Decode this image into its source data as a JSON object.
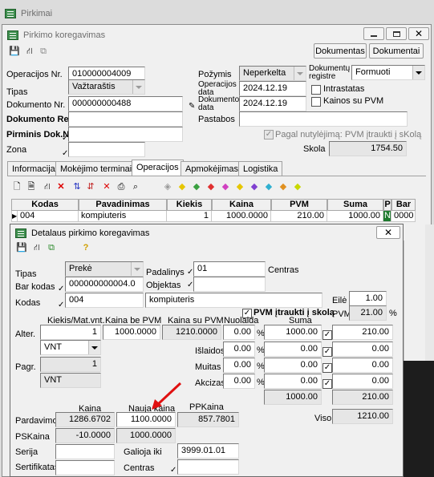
{
  "app": {
    "title": "Pirkimai"
  },
  "edit_window": {
    "title": "Pirkimo koregavimas",
    "buttons": {
      "documents1": "Dokumentas",
      "documents2": "Dokumentai"
    },
    "fields": {
      "operation_no_label": "Operacijos Nr.",
      "operation_no": "010000004009",
      "type_label": "Tipas",
      "type": "Važtaraštis",
      "doc_no_label": "Dokumento Nr.",
      "doc_no": "000000000488",
      "doc_reg_label": "Dokumento Reg.",
      "doc_reg": "",
      "primary_doc_label": "Pirminis Dok.Nr.",
      "primary_doc": "",
      "zone_label": "Zona",
      "zone": "",
      "feature_label": "Požymis",
      "feature": "Neperkelta",
      "doc_register_label": "Dokumentų registre",
      "doc_register": "Formuoti",
      "op_date_label": "Operacijos data",
      "op_date": "2024.12.19",
      "doc_date_label": "Dokumento data",
      "doc_date": "2024.12.19",
      "intrastat_label": "Intrastatas",
      "prices_vat_label": "Kainos su PVM",
      "notes_label": "Pastabos",
      "notes": "",
      "default_vat_label": "Pagal nutylėjimą: PVM įtraukti į sKolą",
      "debt_label": "Skola",
      "debt": "1754.50"
    },
    "tabs": [
      "Informacija",
      "Mokėjimo terminai",
      "Operacijos",
      "Apmokėjimas",
      "Logistika"
    ],
    "grid": {
      "headers": [
        "Kodas",
        "Pavadinimas",
        "Kiekis",
        "Kaina",
        "PVM",
        "Suma",
        "P",
        "Bar"
      ],
      "row": [
        "004",
        "kompiuteris",
        "1",
        "1000.0000",
        "210.00",
        "1000.00",
        "N",
        "0000"
      ]
    }
  },
  "detail_window": {
    "title": "Detalaus pirkimo koregavimas",
    "type_label": "Tipas",
    "type": "Prekė",
    "barcode_label": "Bar kodas",
    "barcode": "000000000004.0",
    "code_label": "Kodas",
    "code": "004",
    "name": "kompiuteris",
    "division_label": "Padalinys",
    "division": "01",
    "centers_label": "Centras",
    "object_label": "Objektas",
    "object": "",
    "row_label": "Eilė",
    "row": "1.00",
    "vat_incl_label": "PVM įtraukti į skolą",
    "vat_label": "PVM",
    "vat": "21.00",
    "vat_pct": "%",
    "col_headers": {
      "qty_unit": "Kiekis/Mat.vnt.",
      "price_no_vat": "Kaina be PVM",
      "price_vat": "Kaina su PVM",
      "discount": "Nuolaida",
      "sum": "Suma"
    },
    "alter_label": "Alter.",
    "alter_qty": "1",
    "price_no_vat": "1000.0000",
    "price_vat": "1210.0000",
    "discount": "0.00",
    "discount_pct": "%",
    "sum": "1000.00",
    "sum_vat": "210.00",
    "unit1": "VNT",
    "pagr_label": "Pagr.",
    "pagr_qty": "1",
    "unit2": "VNT",
    "expenses_label": "Išlaidos",
    "expenses": "0.00",
    "expenses_sum": "0.00",
    "expenses_vat": "0.00",
    "customs_label": "Muitas",
    "customs": "0.00",
    "customs_sum": "0.00",
    "customs_vat": "0.00",
    "excise_label": "Akcizas",
    "excise": "0.00",
    "excise_sum": "0.00",
    "excise_vat": "0.00",
    "total_sum": "1000.00",
    "total_vat": "210.00",
    "price_head": "Kaina",
    "new_price_head": "Nauja kaina",
    "pp_price_head": "PPKaina",
    "sale_label": "Pardavimo",
    "sale_price": "1286.6702",
    "new_price": "1100.0000",
    "pp_price": "857.7801",
    "ps_label": "PSKaina",
    "ps_price": "-10.0000",
    "ps_new": "1000.0000",
    "serial_label": "Serija",
    "serial": "",
    "valid_label": "Galioja iki",
    "valid": "3999.01.01",
    "cert_label": "Sertifikatas",
    "cert": "",
    "center_label": "Centras",
    "center": "",
    "total_label": "Viso",
    "total": "1210.00"
  },
  "colors": {
    "accent": "#2f7d3d",
    "arrow": "#e01010",
    "highlight": "#1e7a2e"
  }
}
